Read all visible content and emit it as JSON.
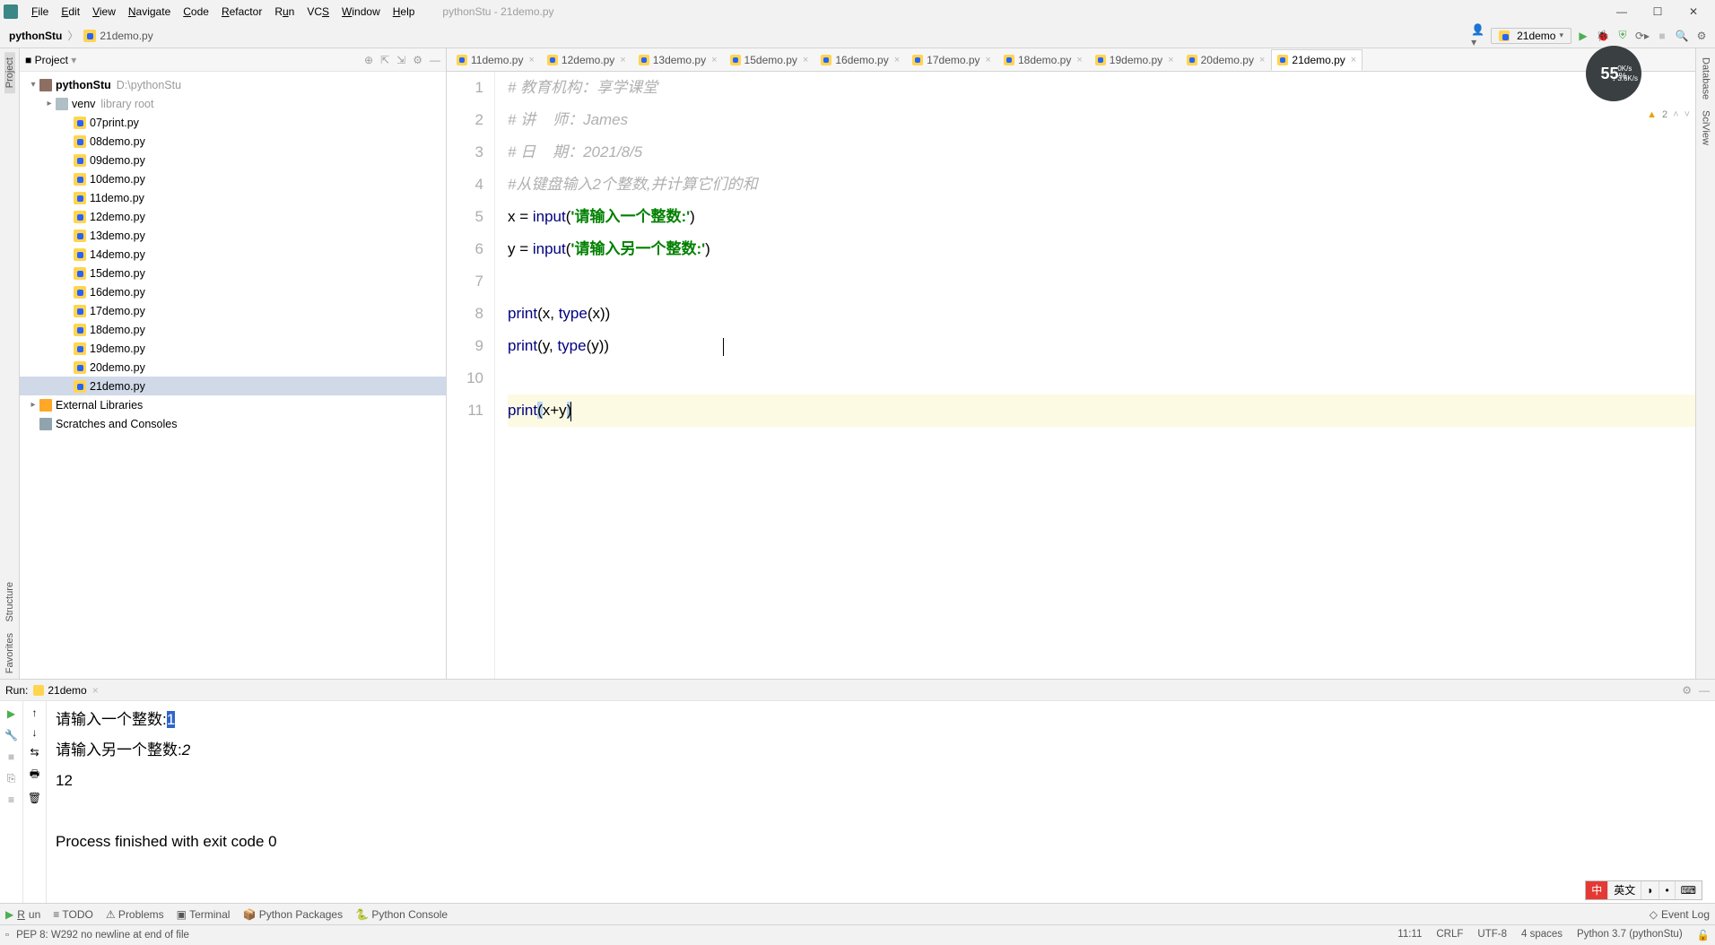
{
  "menu": {
    "items": [
      "File",
      "Edit",
      "View",
      "Navigate",
      "Code",
      "Refactor",
      "Run",
      "VCS",
      "Window",
      "Help"
    ],
    "titlePath": "pythonStu - 21demo.py"
  },
  "breadcrumb": {
    "project": "pythonStu",
    "file": "21demo.py"
  },
  "runConfig": {
    "name": "21demo",
    "dropdown": "▾"
  },
  "projectTool": {
    "title": "Project",
    "rootName": "pythonStu",
    "rootPath": "D:\\pythonStu",
    "venv": "venv",
    "venvHint": "library root",
    "files": [
      "07print.py",
      "08demo.py",
      "09demo.py",
      "10demo.py",
      "11demo.py",
      "12demo.py",
      "13demo.py",
      "14demo.py",
      "15demo.py",
      "16demo.py",
      "17demo.py",
      "18demo.py",
      "19demo.py",
      "20demo.py",
      "21demo.py"
    ],
    "extLib": "External Libraries",
    "scratches": "Scratches and Consoles"
  },
  "editorTabs": [
    "11demo.py",
    "12demo.py",
    "13demo.py",
    "15demo.py",
    "16demo.py",
    "17demo.py",
    "18demo.py",
    "19demo.py",
    "20demo.py",
    "21demo.py"
  ],
  "activeTab": "21demo.py",
  "code": {
    "lines": [
      {
        "n": 1,
        "t": "comment",
        "text": "# 教育机构：享学课堂"
      },
      {
        "n": 2,
        "t": "comment",
        "text": "# 讲    师：James"
      },
      {
        "n": 3,
        "t": "comment",
        "text": "# 日    期：2021/8/5"
      },
      {
        "n": 4,
        "t": "comment",
        "text": "#从键盘输入2个整数,并计算它们的和"
      },
      {
        "n": 5,
        "t": "code",
        "pre": "x = ",
        "fn": "input",
        "str": "'请输入一个整数:'",
        "post": ")"
      },
      {
        "n": 6,
        "t": "code",
        "pre": "y = ",
        "fn": "input",
        "str": "'请输入另一个整数:'",
        "post": ")"
      },
      {
        "n": 7,
        "t": "blank"
      },
      {
        "n": 8,
        "t": "print2",
        "arg": "x",
        "fn2": "type",
        "arg2": "x"
      },
      {
        "n": 9,
        "t": "print2",
        "arg": "y",
        "fn2": "type",
        "arg2": "y"
      },
      {
        "n": 10,
        "t": "blank"
      },
      {
        "n": 11,
        "t": "printxy",
        "expr": "x+y"
      }
    ]
  },
  "meter": {
    "pct": "55",
    "up": "0K/s",
    "dn": "3.6K/s"
  },
  "inspection": {
    "warnCount": "2"
  },
  "sideToolsLeft": [
    "Project",
    "Structure",
    "Favorites"
  ],
  "sideToolsRight": [
    "Database",
    "SciView"
  ],
  "runTool": {
    "title": "Run:",
    "tab": "21demo",
    "lines": [
      {
        "plain": "请输入一个整数:",
        "selected": "1"
      },
      {
        "plain": "请输入另一个整数:",
        "val": "2",
        "ital": true
      },
      {
        "plain": "12"
      },
      {
        "plain": ""
      },
      {
        "plain": "Process finished with exit code 0"
      }
    ]
  },
  "bottomTabs": [
    "Run",
    "TODO",
    "Problems",
    "Terminal",
    "Python Packages",
    "Python Console"
  ],
  "eventLog": "Event Log",
  "status": {
    "msg": "PEP 8: W292 no newline at end of file",
    "pos": "11:11",
    "eol": "CRLF",
    "enc": "UTF-8",
    "indent": "4 spaces",
    "interp": "Python 3.7 (pythonStu)"
  },
  "ime": {
    "lang": "英文"
  }
}
